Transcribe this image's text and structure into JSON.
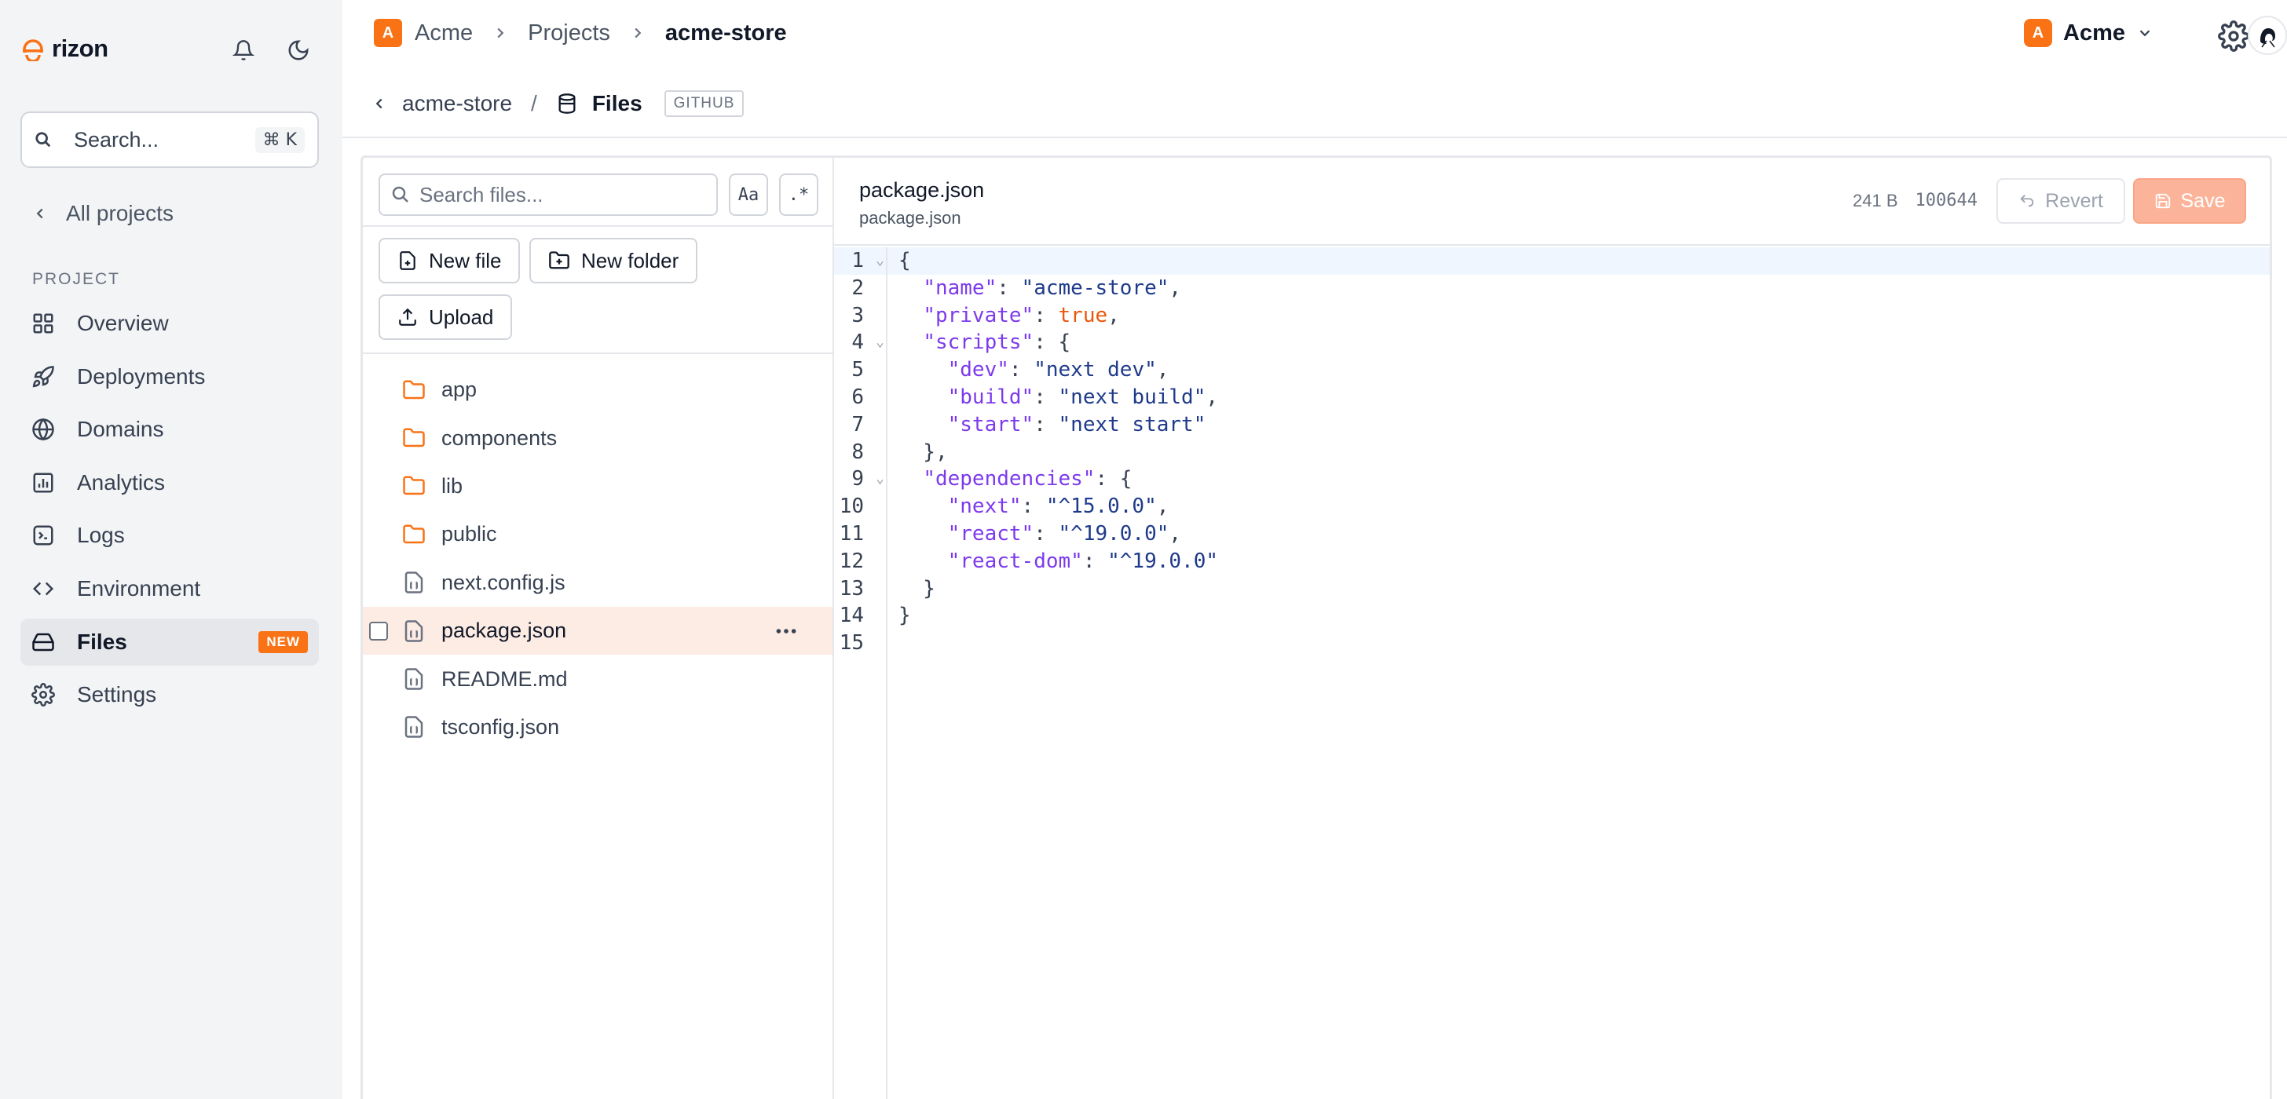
{
  "brand": {
    "name": "rizon",
    "accent": "#f97316"
  },
  "sidebar": {
    "search_placeholder": "Search...",
    "search_shortcut": "⌘ K",
    "back_label": "All projects",
    "section_label": "PROJECT",
    "items": [
      {
        "label": "Overview",
        "icon": "grid-icon"
      },
      {
        "label": "Deployments",
        "icon": "rocket-icon"
      },
      {
        "label": "Domains",
        "icon": "globe-icon"
      },
      {
        "label": "Analytics",
        "icon": "chart-icon"
      },
      {
        "label": "Logs",
        "icon": "terminal-icon"
      },
      {
        "label": "Environment",
        "icon": "code-icon"
      },
      {
        "label": "Files",
        "icon": "drive-icon",
        "badge": "NEW",
        "active": true
      },
      {
        "label": "Settings",
        "icon": "gear-icon"
      }
    ]
  },
  "header": {
    "breadcrumb": {
      "org_initial": "A",
      "org": "Acme",
      "projects": "Projects",
      "current": "acme-store"
    },
    "org_switcher": {
      "initial": "A",
      "name": "Acme"
    }
  },
  "subheader": {
    "project": "acme-store",
    "separator": "/",
    "title": "Files",
    "source_badge": "GITHUB"
  },
  "file_tree": {
    "search_placeholder": "Search files...",
    "case_toggle": "Aa",
    "regex_toggle": ".*",
    "new_file_label": "New file",
    "new_folder_label": "New folder",
    "upload_label": "Upload",
    "entries": [
      {
        "name": "app",
        "type": "folder"
      },
      {
        "name": "components",
        "type": "folder"
      },
      {
        "name": "lib",
        "type": "folder"
      },
      {
        "name": "public",
        "type": "folder"
      },
      {
        "name": "next.config.js",
        "type": "file"
      },
      {
        "name": "package.json",
        "type": "file",
        "selected": true
      },
      {
        "name": "README.md",
        "type": "file"
      },
      {
        "name": "tsconfig.json",
        "type": "file"
      }
    ]
  },
  "editor": {
    "file_name": "package.json",
    "file_path": "package.json",
    "size": "241 B",
    "mode": "100644",
    "revert_label": "Revert",
    "save_label": "Save",
    "line_numbers": [
      "1",
      "2",
      "3",
      "4",
      "5",
      "6",
      "7",
      "8",
      "9",
      "10",
      "11",
      "12",
      "13",
      "14",
      "15"
    ],
    "lines": [
      [
        {
          "t": "{",
          "c": ""
        }
      ],
      [
        {
          "t": "  ",
          "c": ""
        },
        {
          "t": "\"name\"",
          "c": "k"
        },
        {
          "t": ": ",
          "c": ""
        },
        {
          "t": "\"acme-store\"",
          "c": "s"
        },
        {
          "t": ",",
          "c": ""
        }
      ],
      [
        {
          "t": "  ",
          "c": ""
        },
        {
          "t": "\"private\"",
          "c": "k"
        },
        {
          "t": ": ",
          "c": ""
        },
        {
          "t": "true",
          "c": "b"
        },
        {
          "t": ",",
          "c": ""
        }
      ],
      [
        {
          "t": "  ",
          "c": ""
        },
        {
          "t": "\"scripts\"",
          "c": "k"
        },
        {
          "t": ": {",
          "c": ""
        }
      ],
      [
        {
          "t": "    ",
          "c": ""
        },
        {
          "t": "\"dev\"",
          "c": "k"
        },
        {
          "t": ": ",
          "c": ""
        },
        {
          "t": "\"next dev\"",
          "c": "s"
        },
        {
          "t": ",",
          "c": ""
        }
      ],
      [
        {
          "t": "    ",
          "c": ""
        },
        {
          "t": "\"build\"",
          "c": "k"
        },
        {
          "t": ": ",
          "c": ""
        },
        {
          "t": "\"next build\"",
          "c": "s"
        },
        {
          "t": ",",
          "c": ""
        }
      ],
      [
        {
          "t": "    ",
          "c": ""
        },
        {
          "t": "\"start\"",
          "c": "k"
        },
        {
          "t": ": ",
          "c": ""
        },
        {
          "t": "\"next start\"",
          "c": "s"
        }
      ],
      [
        {
          "t": "  },",
          "c": ""
        }
      ],
      [
        {
          "t": "  ",
          "c": ""
        },
        {
          "t": "\"dependencies\"",
          "c": "k"
        },
        {
          "t": ": {",
          "c": ""
        }
      ],
      [
        {
          "t": "    ",
          "c": ""
        },
        {
          "t": "\"next\"",
          "c": "k"
        },
        {
          "t": ": ",
          "c": ""
        },
        {
          "t": "\"^15.0.0\"",
          "c": "s"
        },
        {
          "t": ",",
          "c": ""
        }
      ],
      [
        {
          "t": "    ",
          "c": ""
        },
        {
          "t": "\"react\"",
          "c": "k"
        },
        {
          "t": ": ",
          "c": ""
        },
        {
          "t": "\"^19.0.0\"",
          "c": "s"
        },
        {
          "t": ",",
          "c": ""
        }
      ],
      [
        {
          "t": "    ",
          "c": ""
        },
        {
          "t": "\"react-dom\"",
          "c": "k"
        },
        {
          "t": ": ",
          "c": ""
        },
        {
          "t": "\"^19.0.0\"",
          "c": "s"
        }
      ],
      [
        {
          "t": "  }",
          "c": ""
        }
      ],
      [
        {
          "t": "}",
          "c": ""
        }
      ],
      [
        {
          "t": "",
          "c": ""
        }
      ]
    ],
    "fold_lines": [
      0,
      3,
      8
    ]
  }
}
